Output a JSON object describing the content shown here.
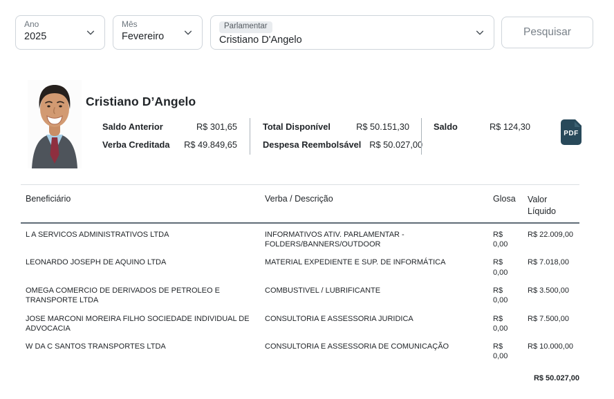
{
  "filters": {
    "ano": {
      "label": "Ano",
      "value": "2025"
    },
    "mes": {
      "label": "Mês",
      "value": "Fevereiro"
    },
    "parlamentar": {
      "label": "Parlamentar",
      "value": "Cristiano D'Angelo"
    },
    "search_label": "Pesquisar"
  },
  "profile": {
    "name": "Cristiano D’Angelo",
    "summary": {
      "saldo_anterior": {
        "label": "Saldo Anterior",
        "value": "R$ 301,65"
      },
      "verba_creditada": {
        "label": "Verba Creditada",
        "value": "R$ 49.849,65"
      },
      "total_disponivel": {
        "label": "Total Disponível",
        "value": "R$ 50.151,30"
      },
      "despesa_reembolsavel": {
        "label": "Despesa Reembolsável",
        "value": "R$ 50.027,00"
      },
      "saldo": {
        "label": "Saldo",
        "value": "R$ 124,30"
      }
    },
    "pdf_icon_label": "PDF"
  },
  "table": {
    "headers": [
      "Beneficiário",
      "Verba / Descrição",
      "Glosa",
      "Valor Líquido"
    ],
    "rows": [
      {
        "beneficiario": "L A SERVICOS ADMINISTRATIVOS LTDA",
        "verba": "INFORMATIVOS ATIV. PARLAMENTAR - FOLDERS/BANNERS/OUTDOOR",
        "glosa": "R$ 0,00",
        "valor": "R$ 22.009,00"
      },
      {
        "beneficiario": "LEONARDO JOSEPH DE AQUINO LTDA",
        "verba": "MATERIAL EXPEDIENTE E SUP. DE INFORMÁTICA",
        "glosa": "R$ 0,00",
        "valor": "R$ 7.018,00"
      },
      {
        "beneficiario": "OMEGA COMERCIO DE DERIVADOS DE PETROLEO E TRANSPORTE LTDA",
        "verba": "COMBUSTIVEL / LUBRIFICANTE",
        "glosa": "R$ 0,00",
        "valor": "R$ 3.500,00"
      },
      {
        "beneficiario": "JOSE MARCONI MOREIRA FILHO SOCIEDADE INDIVIDUAL DE ADVOCACIA",
        "verba": "CONSULTORIA E ASSESSORIA JURIDICA",
        "glosa": "R$ 0,00",
        "valor": "R$ 7.500,00"
      },
      {
        "beneficiario": "W DA C SANTOS TRANSPORTES LTDA",
        "verba": "CONSULTORIA E ASSESSORIA DE COMUNICAÇÃO",
        "glosa": "R$ 0,00",
        "valor": "R$ 10.000,00"
      }
    ],
    "total": "R$ 50.027,00"
  },
  "colors": {
    "pdf_icon_bg": "#28495a",
    "header_rule": "#5f6b76",
    "input_border": "#ced4da",
    "label_gray": "#6c757d",
    "text_dark": "#212529"
  }
}
